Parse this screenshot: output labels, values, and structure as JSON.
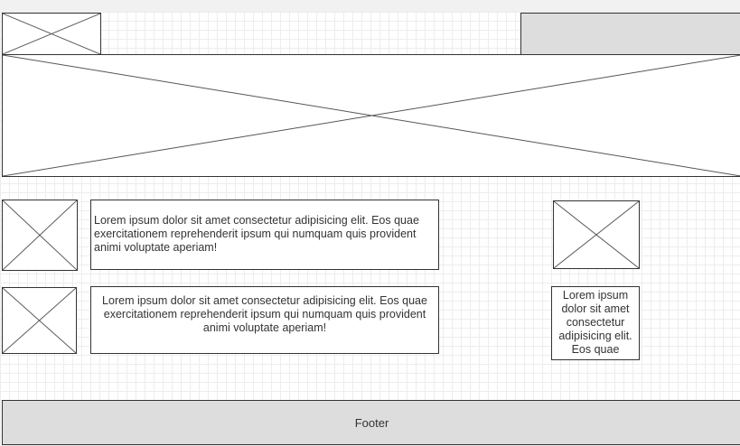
{
  "body_text": {
    "item_1": "Lorem ipsum dolor sit amet consectetur adipisicing elit. Eos quae exercitationem reprehenderit ipsum qui numquam quis provident animi voluptate aperiam!",
    "item_2": "Lorem ipsum dolor sit amet consectetur adipisicing elit. Eos quae exercitationem reprehenderit ipsum qui numquam quis provident animi voluptate aperiam!",
    "side_text": "Lorem ipsum dolor sit amet consectetur adipisicing elit. Eos quae"
  },
  "footer": {
    "label": "Footer"
  }
}
